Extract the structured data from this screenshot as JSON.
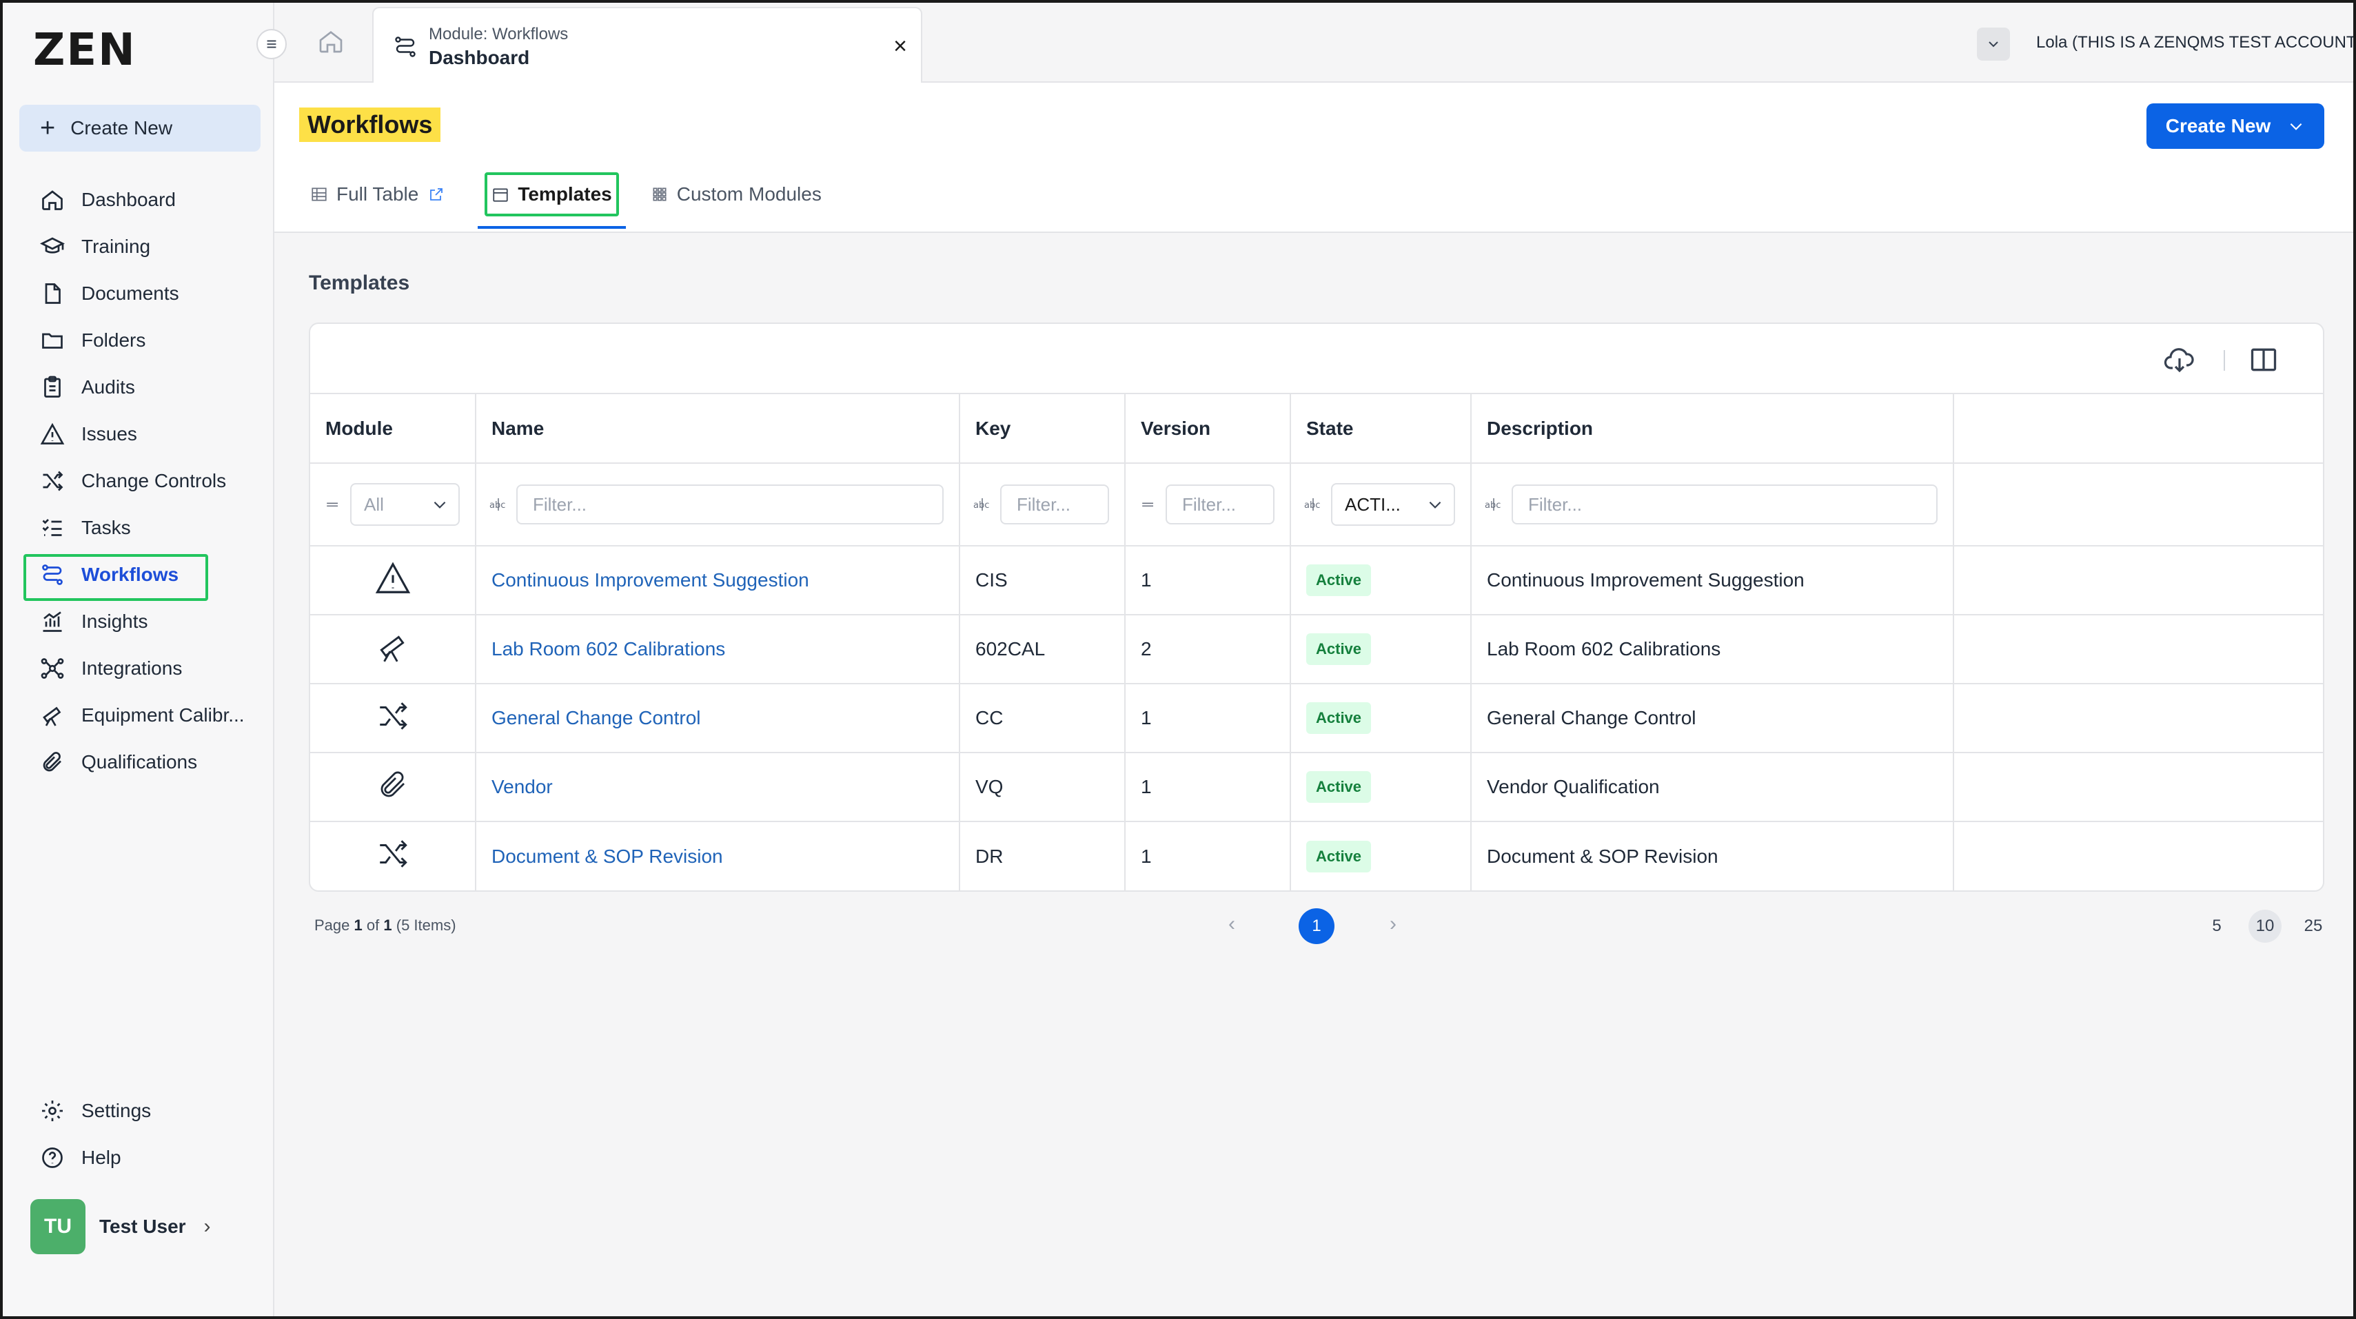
{
  "app": {
    "logo": "ZEN"
  },
  "sidebar": {
    "create_new_label": "Create New",
    "items": [
      {
        "label": "Dashboard",
        "icon": "home-icon"
      },
      {
        "label": "Training",
        "icon": "graduation-cap-icon"
      },
      {
        "label": "Documents",
        "icon": "document-icon"
      },
      {
        "label": "Folders",
        "icon": "folder-icon"
      },
      {
        "label": "Audits",
        "icon": "clipboard-icon"
      },
      {
        "label": "Issues",
        "icon": "warning-icon"
      },
      {
        "label": "Change Controls",
        "icon": "shuffle-icon"
      },
      {
        "label": "Tasks",
        "icon": "checklist-icon"
      },
      {
        "label": "Workflows",
        "icon": "workflow-icon",
        "active": true
      },
      {
        "label": "Insights",
        "icon": "chart-icon"
      },
      {
        "label": "Integrations",
        "icon": "network-icon"
      },
      {
        "label": "Equipment Calibr...",
        "icon": "telescope-icon"
      },
      {
        "label": "Qualifications",
        "icon": "paperclip-icon"
      }
    ],
    "bottom": [
      {
        "label": "Settings",
        "icon": "gear-icon"
      },
      {
        "label": "Help",
        "icon": "help-icon"
      }
    ],
    "user": {
      "initials": "TU",
      "name": "Test User"
    }
  },
  "topbar": {
    "tab_subtitle": "Module: Workflows",
    "tab_title": "Dashboard",
    "close_glyph": "×",
    "account": "Lola (THIS IS A ZENQMS TEST ACCOUNT)"
  },
  "header": {
    "title": "Workflows",
    "create_new_label": "Create New",
    "tabs": [
      {
        "label": "Full Table"
      },
      {
        "label": "Templates",
        "active": true
      },
      {
        "label": "Custom Modules"
      }
    ]
  },
  "section_title": "Templates",
  "table": {
    "columns": [
      "Module",
      "Name",
      "Key",
      "Version",
      "State",
      "Description"
    ],
    "filters": {
      "module": "All",
      "name": "Filter...",
      "key": "Filter...",
      "version": "Filter...",
      "state": "ACTI...",
      "description": "Filter..."
    },
    "rows": [
      {
        "icon": "warning-icon",
        "name": "Continuous Improvement Suggestion",
        "key": "CIS",
        "version": "1",
        "state": "Active",
        "description": "Continuous Improvement Suggestion"
      },
      {
        "icon": "telescope-icon",
        "name": "Lab Room 602 Calibrations",
        "key": "602CAL",
        "version": "2",
        "state": "Active",
        "description": "Lab Room 602 Calibrations"
      },
      {
        "icon": "shuffle-icon",
        "name": "General Change Control",
        "key": "CC",
        "version": "1",
        "state": "Active",
        "description": "General Change Control"
      },
      {
        "icon": "paperclip-icon",
        "name": "Vendor",
        "key": "VQ",
        "version": "1",
        "state": "Active",
        "description": "Vendor Qualification"
      },
      {
        "icon": "shuffle-icon",
        "name": "Document & SOP Revision",
        "key": "DR",
        "version": "1",
        "state": "Active",
        "description": "Document & SOP Revision"
      }
    ]
  },
  "pagination": {
    "page_word": "Page",
    "current": "1",
    "of_word": "of",
    "total": "1",
    "items_text": "(5 Items)",
    "sizes": [
      "5",
      "10",
      "25"
    ],
    "selected_size": "10"
  },
  "colors": {
    "accent": "#0b63e5",
    "highlight": "#fde047",
    "annotation": "#22c55e",
    "active_badge": "#15803d"
  }
}
